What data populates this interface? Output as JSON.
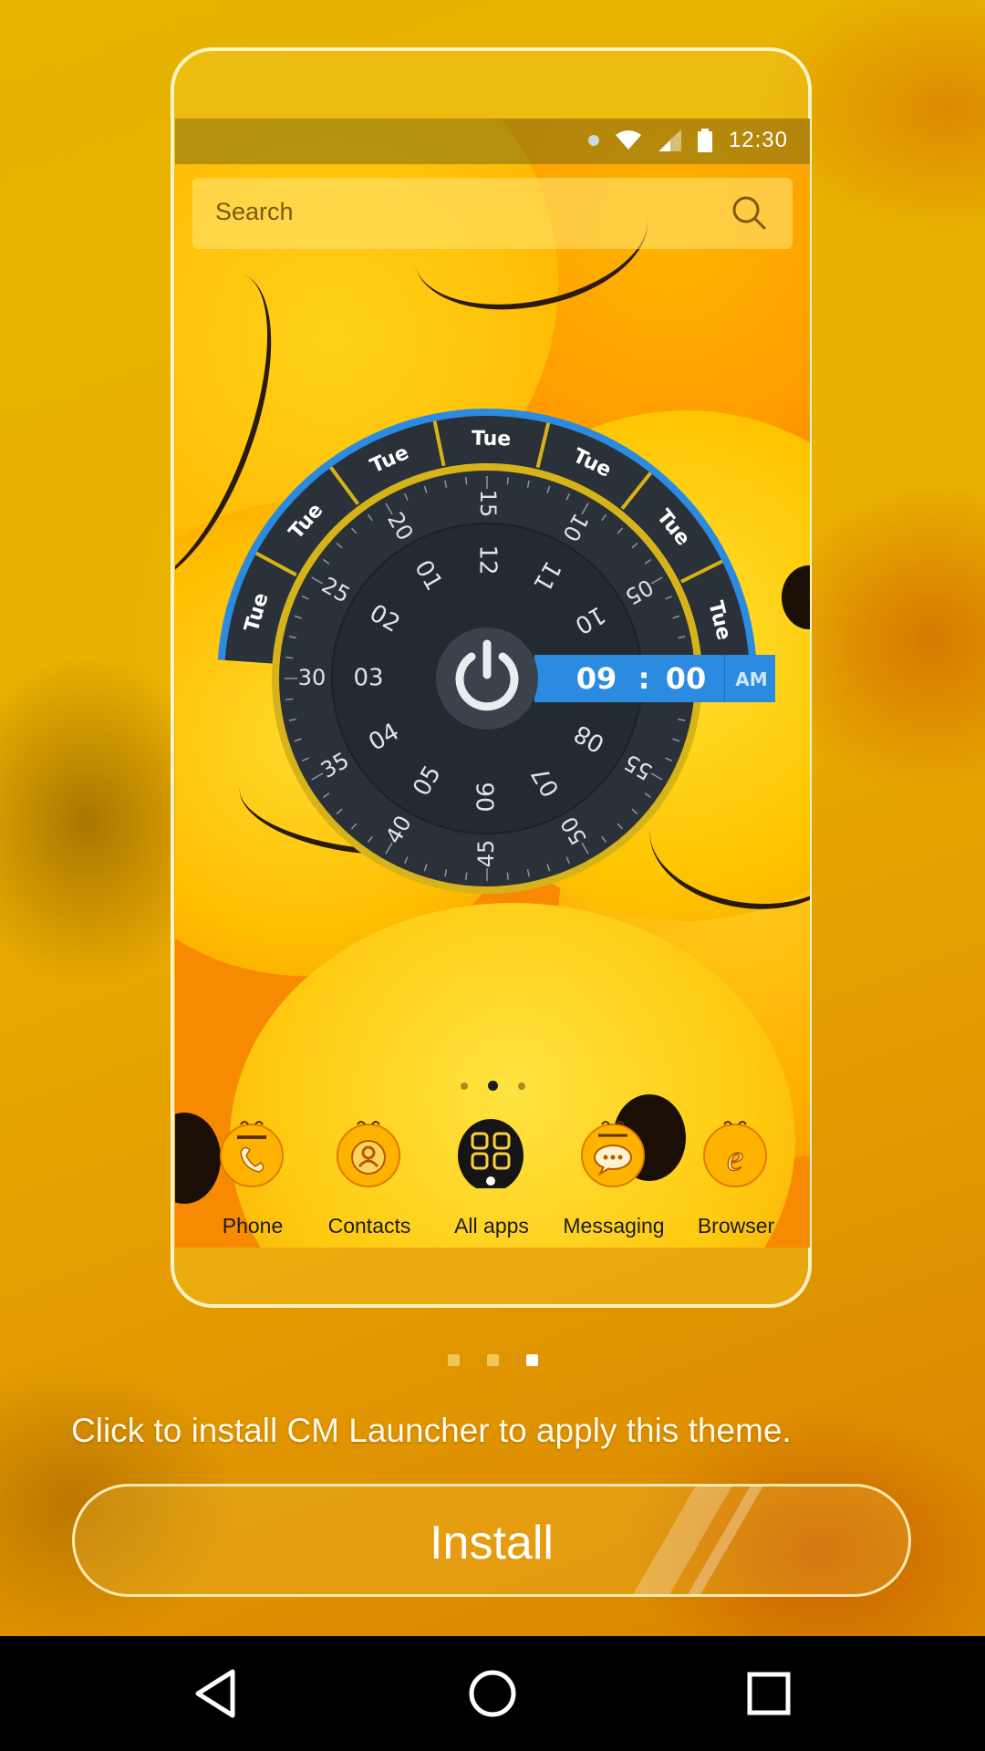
{
  "status_bar": {
    "time": "12:30"
  },
  "search": {
    "placeholder": "Search"
  },
  "clock_widget": {
    "day_labels": [
      "Tue",
      "Tue",
      "Tue",
      "Tue",
      "Tue",
      "Tue",
      "Tue"
    ],
    "minute_ring": [
      "15",
      "10",
      "05",
      "55",
      "50",
      "45",
      "40",
      "35",
      "30",
      "25",
      "20"
    ],
    "hour_ring": [
      "12",
      "11",
      "10",
      "08",
      "07",
      "06",
      "05",
      "04",
      "03",
      "02",
      "01"
    ],
    "time": {
      "hour": "09",
      "separator": ":",
      "minute": "00",
      "ampm": "AM"
    }
  },
  "home_pages": {
    "count": 3,
    "active": 2
  },
  "dock": [
    {
      "label": "Phone",
      "icon": "phone-smiley-icon"
    },
    {
      "label": "Contacts",
      "icon": "contacts-smiley-icon"
    },
    {
      "label": "All apps",
      "icon": "all-apps-icon"
    },
    {
      "label": "Messaging",
      "icon": "messaging-smiley-icon"
    },
    {
      "label": "Browser",
      "icon": "browser-smiley-icon"
    }
  ],
  "preview_indicator": {
    "count": 3,
    "active": 3
  },
  "install_message": "Click to install CM Launcher to apply this theme.",
  "install_button": "Install",
  "colors": {
    "accent_blue": "#2b8be0",
    "dial_dark": "#2a3138",
    "ring_gold": "#d7b31a"
  }
}
